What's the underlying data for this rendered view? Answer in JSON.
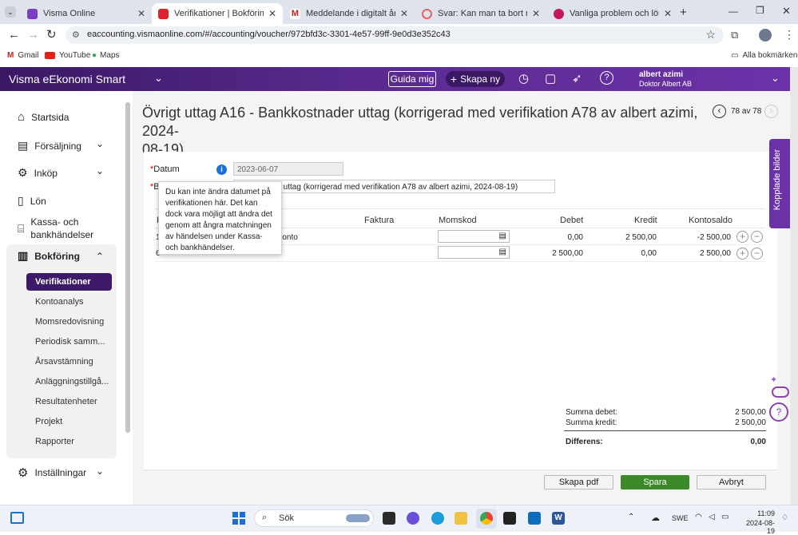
{
  "browser": {
    "tabs": [
      {
        "label": "Visma Online",
        "active": false,
        "icon_color": "#7a3fc0"
      },
      {
        "label": "Verifikationer | Bokföring",
        "active": true,
        "icon_color": "#d9232d"
      },
      {
        "label": "Meddelande i digitalt årsredov",
        "active": false,
        "icon_color": "#c5221f"
      },
      {
        "label": "Svar: Kan man ta bort räkenska",
        "active": false,
        "icon_color": "#e06666"
      },
      {
        "label": "Vanliga problem och lösningar",
        "active": false,
        "icon_color": "#c2185b"
      }
    ],
    "url": "eaccounting.vismaonline.com/#/accounting/voucher/972bfd3c-3301-4e57-99ff-9e0d3e352c43",
    "bookmarks": [
      "Gmail",
      "YouTube",
      "Maps"
    ],
    "all_bookmarks": "Alla bokmärken"
  },
  "app": {
    "brand": "Visma eEkonomi Smart",
    "guide_button": "Guida mig",
    "create_button": "Skapa ny",
    "user_name": "albert azimi",
    "company": "Doktor Albert AB"
  },
  "sidebar": {
    "items": [
      {
        "label": "Startsida",
        "icon": "home-icon"
      },
      {
        "label": "Försäljning",
        "icon": "cash-register-icon",
        "chevron": "⌄"
      },
      {
        "label": "Inköp",
        "icon": "gear-box-icon",
        "chevron": "⌄"
      },
      {
        "label": "Lön",
        "icon": "document-icon"
      },
      {
        "label": "Kassa- och",
        "label2": "bankhändelser",
        "icon": "bank-icon"
      },
      {
        "label": "Bokföring",
        "icon": "ledger-icon",
        "chevron": "⌃"
      },
      {
        "label": "Inställningar",
        "icon": "settings-icon",
        "chevron": "⌄"
      }
    ],
    "subitems": [
      "Verifikationer",
      "Kontoanalys",
      "Momsredovisning",
      "Periodisk samm...",
      "Årsavstämning",
      "Anläggningstillgå...",
      "Resultatenheter",
      "Projekt",
      "Rapporter"
    ]
  },
  "voucher": {
    "title_line1": "Övrigt uttag A16  -  Bankkostnader uttag (korrigerad med verifikation A78 av albert azimi, 2024-",
    "title_line2": "08-19)",
    "pager": "78 av 78",
    "date_label": "Datum",
    "date_value": "2023-06-07",
    "desc_label_frag": "B",
    "desc_value_frag": "er uttag (korrigerad med verifikation A78 av albert azimi, 2024-08-19)",
    "tooltip": "Du kan inte ändra datumet på verifikationen här. Det kan dock vara möjligt att ändra det genom att ångra matchningen av händelsen under Kassa- och bankhändelser.",
    "columns": {
      "konto_frag": "K",
      "faktura": "Faktura",
      "momskod": "Momskod",
      "debet": "Debet",
      "kredit": "Kredit",
      "kontosaldo": "Kontosaldo"
    },
    "rows": [
      {
        "account_frag": "1",
        "name_frag": "rskonto",
        "debet": "0,00",
        "kredit": "2 500,00",
        "saldo": "-2 500,00"
      },
      {
        "account_frag": "6",
        "name_frag": "",
        "debet": "2 500,00",
        "kredit": "0,00",
        "saldo": "2 500,00"
      }
    ],
    "summa_debet_label": "Summa debet:",
    "summa_debet": "2 500,00",
    "summa_kredit_label": "Summa kredit:",
    "summa_kredit": "2 500,00",
    "differens_label": "Differens:",
    "differens": "0,00",
    "btn_pdf": "Skapa pdf",
    "btn_save": "Spara",
    "btn_cancel": "Avbryt",
    "side_tab": "Kopplade bilder"
  },
  "taskbar": {
    "search": "Sök",
    "lang": "SWE",
    "time": "11:09",
    "date": "2024-08-19"
  },
  "colors": {
    "brand_purple": "#4b2179",
    "save_green": "#3b8a2a",
    "active_nav": "#3d1a67"
  }
}
